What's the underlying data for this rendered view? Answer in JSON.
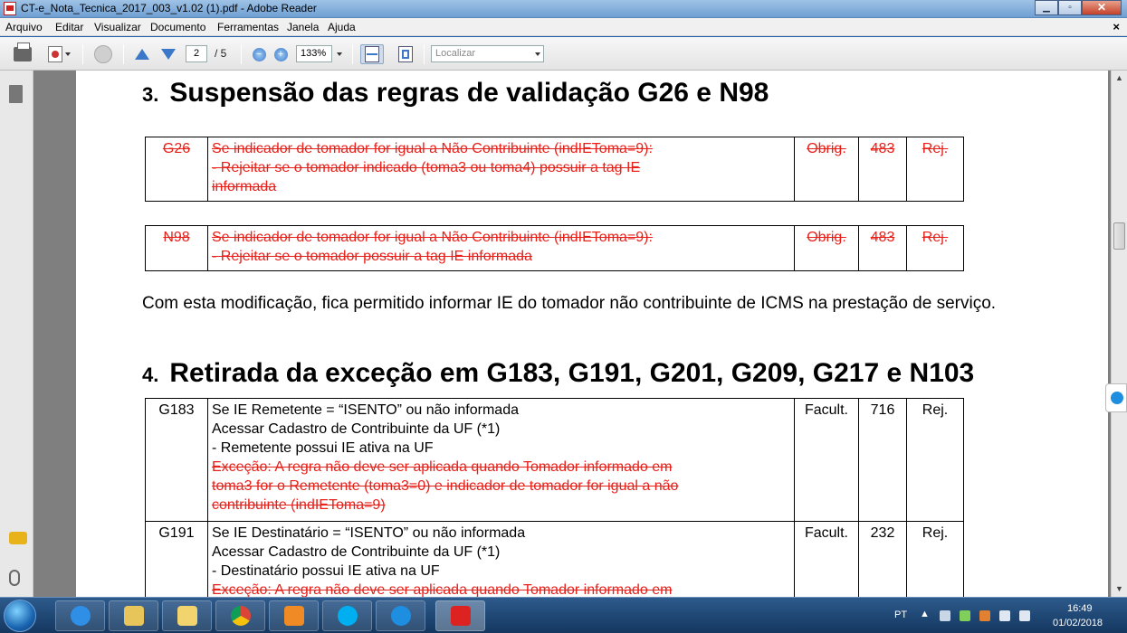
{
  "window": {
    "title": "CT-e_Nota_Tecnica_2017_003_v1.02 (1).pdf - Adobe Reader",
    "minimize": "▁",
    "restore": "▫",
    "close": "✕"
  },
  "menu": {
    "items": [
      "Arquivo",
      "Editar",
      "Visualizar",
      "Documento",
      "Ferramentas",
      "Janela",
      "Ajuda"
    ],
    "close_doc": "×"
  },
  "toolbar": {
    "page_current": "2",
    "page_total": "/ 5",
    "zoom": "133%",
    "search_placeholder": "Localizar",
    "zoom_out": "−",
    "zoom_in": "+"
  },
  "document": {
    "section3": {
      "number": "3.",
      "title": "Suspensão das regras de validação G26 e N98"
    },
    "table_g26": {
      "code": "G26",
      "lines": [
        "Se indicador de tomador for igual a Não Contribuinte (indIEToma=9):",
        "- Rejeitar se o tomador indicado (toma3 ou toma4) possuir a tag IE",
        "informada"
      ],
      "requirement": "Obrig.",
      "error": "483",
      "action": "Rej."
    },
    "table_n98": {
      "code": "N98",
      "lines": [
        "Se indicador de tomador for igual a Não Contribuinte (indIEToma=9):",
        "- Rejeitar se o tomador possuir a tag IE informada"
      ],
      "requirement": "Obrig.",
      "error": "483",
      "action": "Rej."
    },
    "paragraph": "Com esta modificação, fica permitido informar IE do tomador não contribuinte de ICMS na prestação de serviço.",
    "section4": {
      "number": "4.",
      "title": "Retirada da exceção em G183, G191, G201, G209, G217 e N103"
    },
    "table_g183": {
      "code": "G183",
      "lines": [
        "Se IE Remetente = “ISENTO” ou não informada",
        "Acessar Cadastro de Contribuinte da UF (*1)",
        "- Remetente possui IE ativa na UF"
      ],
      "struck_lines": [
        "Exceção: A regra não deve ser aplicada quando Tomador informado em",
        "toma3 for o Remetente (toma3=0) e indicador de tomador for igual a não",
        "contribuinte (indIEToma=9)"
      ],
      "requirement": "Facult.",
      "error": "716",
      "action": "Rej."
    },
    "table_g191": {
      "code": "G191",
      "lines": [
        "Se IE Destinatário = “ISENTO” ou não informada",
        "Acessar Cadastro de Contribuinte da UF (*1)",
        "- Destinatário possui IE ativa na UF"
      ],
      "struck_lines": [
        "Exceção: A regra não deve ser aplicada quando Tomador informado em"
      ],
      "requirement": "Facult.",
      "error": "232",
      "action": "Rej."
    }
  },
  "taskbar": {
    "language": "PT",
    "time": "16:49",
    "date": "01/02/2018"
  },
  "colors": {
    "strike_red": "#e8201a",
    "taskbar": "#1e477a"
  }
}
